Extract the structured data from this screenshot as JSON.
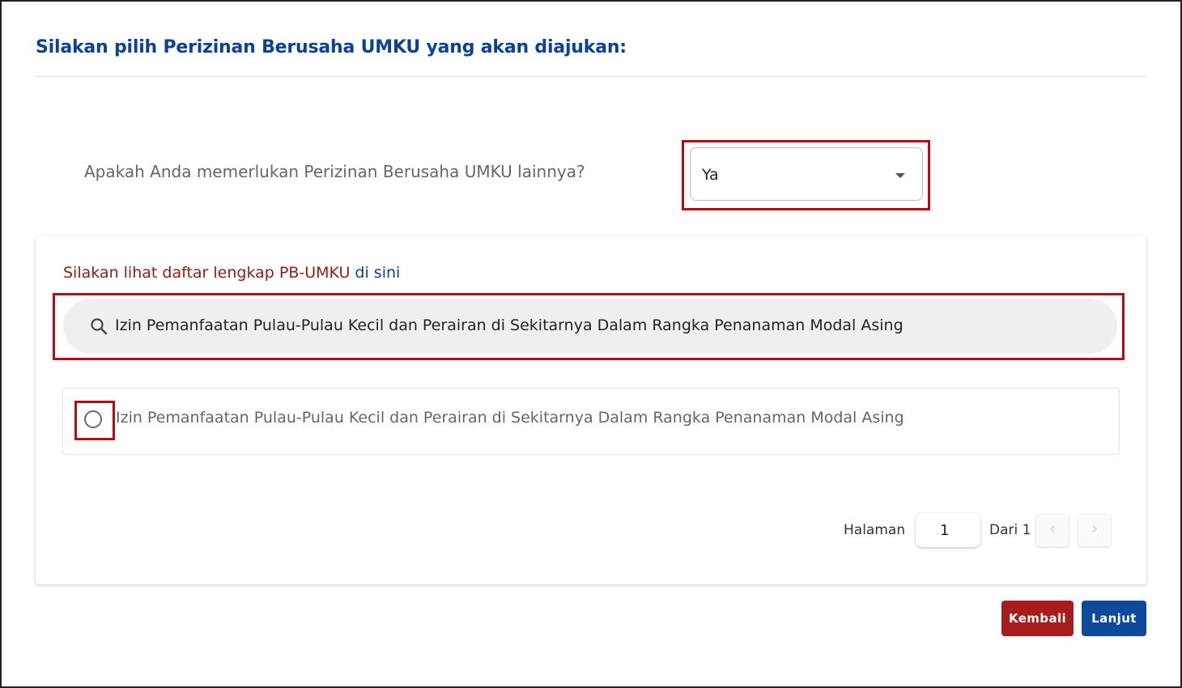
{
  "header": {
    "title": "Silakan pilih Perizinan Berusaha UMKU yang akan diajukan:"
  },
  "question": {
    "label": "Apakah Anda memerlukan Perizinan Berusaha UMKU lainnya?",
    "selected_value": "Ya"
  },
  "list_section": {
    "info_text": "Silakan lihat daftar lengkap PB-UMKU ",
    "info_link": "di sini",
    "search_value": "Izin Pemanfaatan Pulau-Pulau Kecil dan Perairan di Sekitarnya Dalam Rangka Penanaman Modal Asing",
    "results": [
      {
        "label": "Izin Pemanfaatan Pulau-Pulau Kecil dan Perairan di Sekitarnya Dalam Rangka Penanaman Modal Asing",
        "selected": false
      }
    ]
  },
  "pagination": {
    "label": "Halaman",
    "current_page": "1",
    "of_label": "Dari 1",
    "prev_icon": "‹",
    "next_icon": "›"
  },
  "actions": {
    "back_label": "Kembali",
    "next_label": "Lanjut"
  },
  "colors": {
    "title_blue": "#0b4196",
    "highlight_red": "#b40c12",
    "back_button": "#a71d1d",
    "next_button": "#0d4a9c"
  },
  "icons": {
    "search": "search-icon",
    "dropdown": "caret-down-icon",
    "radio": "radio-unchecked-icon"
  }
}
